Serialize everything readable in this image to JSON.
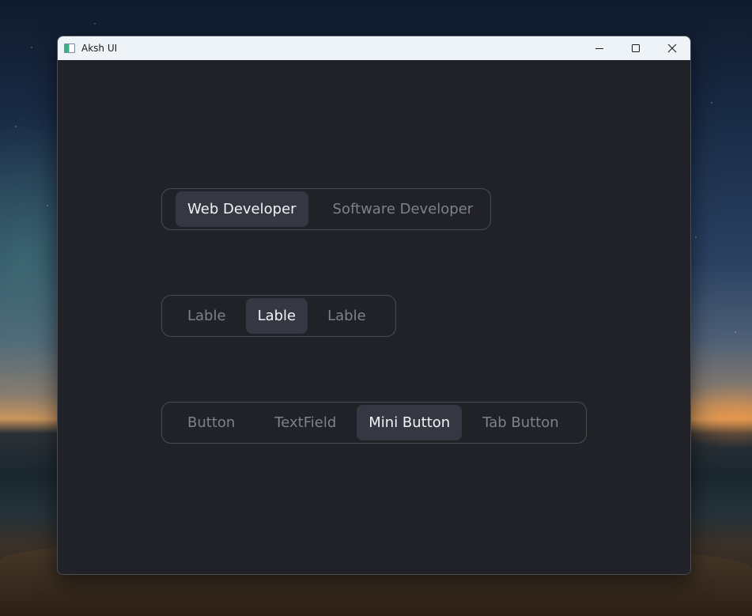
{
  "window": {
    "title": "Aksh UI",
    "background_color": "#212227",
    "titlebar_color": "#eef3f8",
    "caption_icons": [
      "minimize-icon",
      "maximize-icon",
      "close-icon"
    ]
  },
  "theme": {
    "active_segment_bg": "#353843",
    "active_text": "#f2f3f5",
    "inactive_text": "#7f8189",
    "border": "#4a4c53"
  },
  "segmented_controls": [
    {
      "items": [
        "Web Developer",
        "Software Developer"
      ],
      "selected": "Web Developer"
    },
    {
      "items": [
        "Lable",
        "Lable",
        "Lable"
      ],
      "selected_index": 1
    },
    {
      "items": [
        "Button",
        "TextField",
        "Mini Button",
        "Tab Button"
      ],
      "selected": "Mini Button"
    }
  ]
}
